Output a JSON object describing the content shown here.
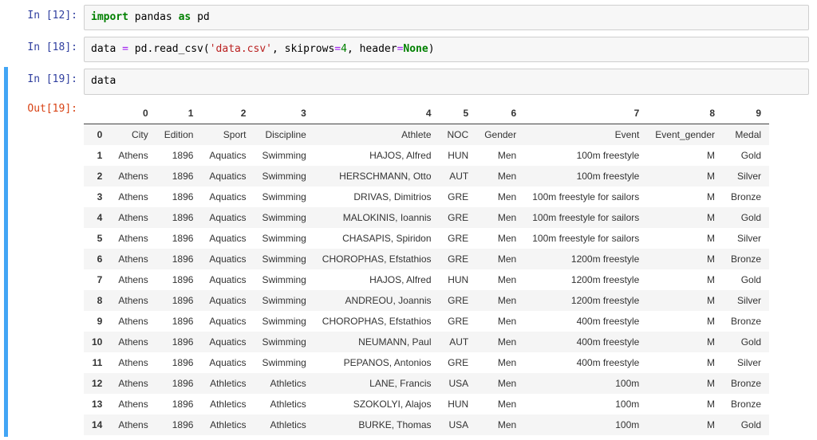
{
  "cells": [
    {
      "in_label": "In [12]:",
      "code_html": "<span class='kw-green'>import</span> pandas <span class='kw-green'>as</span> pd"
    },
    {
      "in_label": "In [18]:",
      "code_html": "data <span class='op-purple'>=</span> pd.read_csv(<span class='str-red'>'data.csv'</span>, skiprows<span class='op-purple'>=</span><span class='num-green'>4</span>, header<span class='op-purple'>=</span><span class='kw-green'>None</span>)"
    },
    {
      "in_label": "In [19]:",
      "out_label": "Out[19]:",
      "code_html": "data",
      "selected": true
    }
  ],
  "table": {
    "columns": [
      "0",
      "1",
      "2",
      "3",
      "4",
      "5",
      "6",
      "7",
      "8",
      "9"
    ],
    "rows": [
      {
        "idx": "0",
        "c": [
          "City",
          "Edition",
          "Sport",
          "Discipline",
          "Athlete",
          "NOC",
          "Gender",
          "Event",
          "Event_gender",
          "Medal"
        ]
      },
      {
        "idx": "1",
        "c": [
          "Athens",
          "1896",
          "Aquatics",
          "Swimming",
          "HAJOS, Alfred",
          "HUN",
          "Men",
          "100m freestyle",
          "M",
          "Gold"
        ]
      },
      {
        "idx": "2",
        "c": [
          "Athens",
          "1896",
          "Aquatics",
          "Swimming",
          "HERSCHMANN, Otto",
          "AUT",
          "Men",
          "100m freestyle",
          "M",
          "Silver"
        ]
      },
      {
        "idx": "3",
        "c": [
          "Athens",
          "1896",
          "Aquatics",
          "Swimming",
          "DRIVAS, Dimitrios",
          "GRE",
          "Men",
          "100m freestyle for sailors",
          "M",
          "Bronze"
        ]
      },
      {
        "idx": "4",
        "c": [
          "Athens",
          "1896",
          "Aquatics",
          "Swimming",
          "MALOKINIS, Ioannis",
          "GRE",
          "Men",
          "100m freestyle for sailors",
          "M",
          "Gold"
        ]
      },
      {
        "idx": "5",
        "c": [
          "Athens",
          "1896",
          "Aquatics",
          "Swimming",
          "CHASAPIS, Spiridon",
          "GRE",
          "Men",
          "100m freestyle for sailors",
          "M",
          "Silver"
        ]
      },
      {
        "idx": "6",
        "c": [
          "Athens",
          "1896",
          "Aquatics",
          "Swimming",
          "CHOROPHAS, Efstathios",
          "GRE",
          "Men",
          "1200m freestyle",
          "M",
          "Bronze"
        ]
      },
      {
        "idx": "7",
        "c": [
          "Athens",
          "1896",
          "Aquatics",
          "Swimming",
          "HAJOS, Alfred",
          "HUN",
          "Men",
          "1200m freestyle",
          "M",
          "Gold"
        ]
      },
      {
        "idx": "8",
        "c": [
          "Athens",
          "1896",
          "Aquatics",
          "Swimming",
          "ANDREOU, Joannis",
          "GRE",
          "Men",
          "1200m freestyle",
          "M",
          "Silver"
        ]
      },
      {
        "idx": "9",
        "c": [
          "Athens",
          "1896",
          "Aquatics",
          "Swimming",
          "CHOROPHAS, Efstathios",
          "GRE",
          "Men",
          "400m freestyle",
          "M",
          "Bronze"
        ]
      },
      {
        "idx": "10",
        "c": [
          "Athens",
          "1896",
          "Aquatics",
          "Swimming",
          "NEUMANN, Paul",
          "AUT",
          "Men",
          "400m freestyle",
          "M",
          "Gold"
        ]
      },
      {
        "idx": "11",
        "c": [
          "Athens",
          "1896",
          "Aquatics",
          "Swimming",
          "PEPANOS, Antonios",
          "GRE",
          "Men",
          "400m freestyle",
          "M",
          "Silver"
        ]
      },
      {
        "idx": "12",
        "c": [
          "Athens",
          "1896",
          "Athletics",
          "Athletics",
          "LANE, Francis",
          "USA",
          "Men",
          "100m",
          "M",
          "Bronze"
        ]
      },
      {
        "idx": "13",
        "c": [
          "Athens",
          "1896",
          "Athletics",
          "Athletics",
          "SZOKOLYI, Alajos",
          "HUN",
          "Men",
          "100m",
          "M",
          "Bronze"
        ]
      },
      {
        "idx": "14",
        "c": [
          "Athens",
          "1896",
          "Athletics",
          "Athletics",
          "BURKE, Thomas",
          "USA",
          "Men",
          "100m",
          "M",
          "Gold"
        ]
      }
    ]
  }
}
